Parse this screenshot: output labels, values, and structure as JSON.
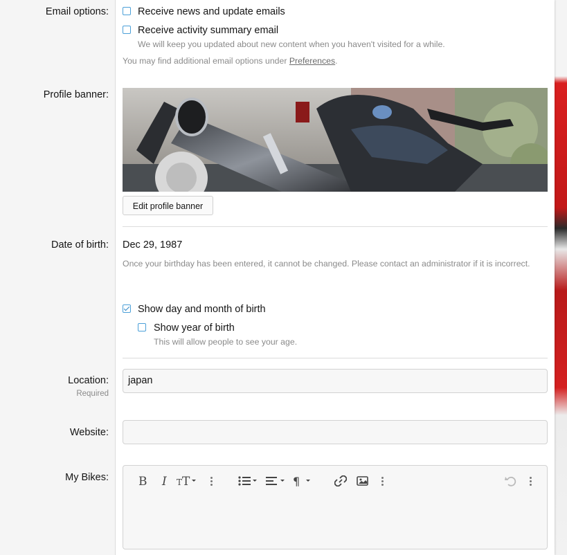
{
  "email": {
    "label": "Email options:",
    "news_label": "Receive news and update emails",
    "news_checked": false,
    "activity_label": "Receive activity summary email",
    "activity_checked": false,
    "activity_hint": "We will keep you updated about new content when you haven't visited for a while.",
    "more_prefix": "You may find additional email options under ",
    "more_link": "Preferences",
    "more_suffix": "."
  },
  "banner": {
    "label": "Profile banner:",
    "edit_label": "Edit profile banner"
  },
  "dob": {
    "label": "Date of birth:",
    "value": "Dec 29, 1987",
    "hint": "Once your birthday has been entered, it cannot be changed. Please contact an administrator if it is incorrect.",
    "show_daymonth_label": "Show day and month of birth",
    "show_daymonth_checked": true,
    "show_year_label": "Show year of birth",
    "show_year_checked": false,
    "show_year_hint": "This will allow people to see your age."
  },
  "location": {
    "label": "Location:",
    "required": "Required",
    "value": "japan"
  },
  "website": {
    "label": "Website:",
    "value": ""
  },
  "bikes": {
    "label": "My Bikes:",
    "toolbar": [
      "bold-icon",
      "italic-icon",
      "font-size-icon",
      "more-icon",
      "list-icon",
      "align-icon",
      "paragraph-icon",
      "link-icon",
      "image-icon",
      "more-icon",
      "undo-icon",
      "more-icon"
    ]
  },
  "colors": {
    "accent": "#4a9fd8",
    "label_bg": "#f5f5f5",
    "hint_text": "#8a8a8a"
  }
}
